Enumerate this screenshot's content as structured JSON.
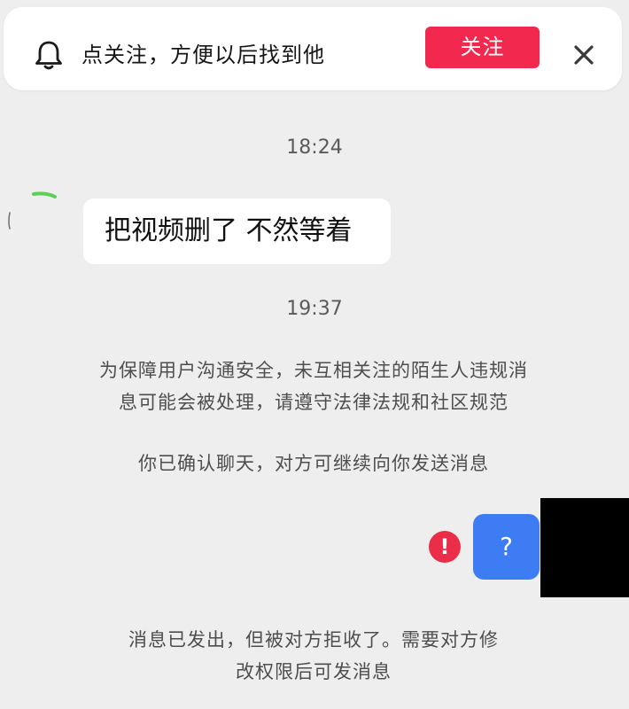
{
  "banner": {
    "text": "点关注，方便以后找到他",
    "follow_label": "关注",
    "icons": {
      "bell": "bell-icon",
      "close": "close-icon"
    }
  },
  "messages": {
    "timestamp_1": "18:24",
    "incoming_text": "把视频删了 不然等着",
    "timestamp_2": "19:37",
    "outgoing_text": "?",
    "error_mark": "!"
  },
  "notices": {
    "safety": [
      "为保障用户沟通安全，未互相关注的陌生人违规消",
      "息可能会被处理，请遵守法律法规和社区规范"
    ],
    "chat_confirmed": "你已确认聊天，对方可继续向你发送消息",
    "rejected": [
      "消息已发出，但被对方拒收了。需要对方修",
      "改权限后可发消息"
    ]
  },
  "colors": {
    "background": "#eeeeee",
    "follow_button": "#f2284f",
    "outgoing_bubble": "#3d7cf2",
    "error_badge": "#ea2e49",
    "incoming_bubble": "#ffffff"
  }
}
